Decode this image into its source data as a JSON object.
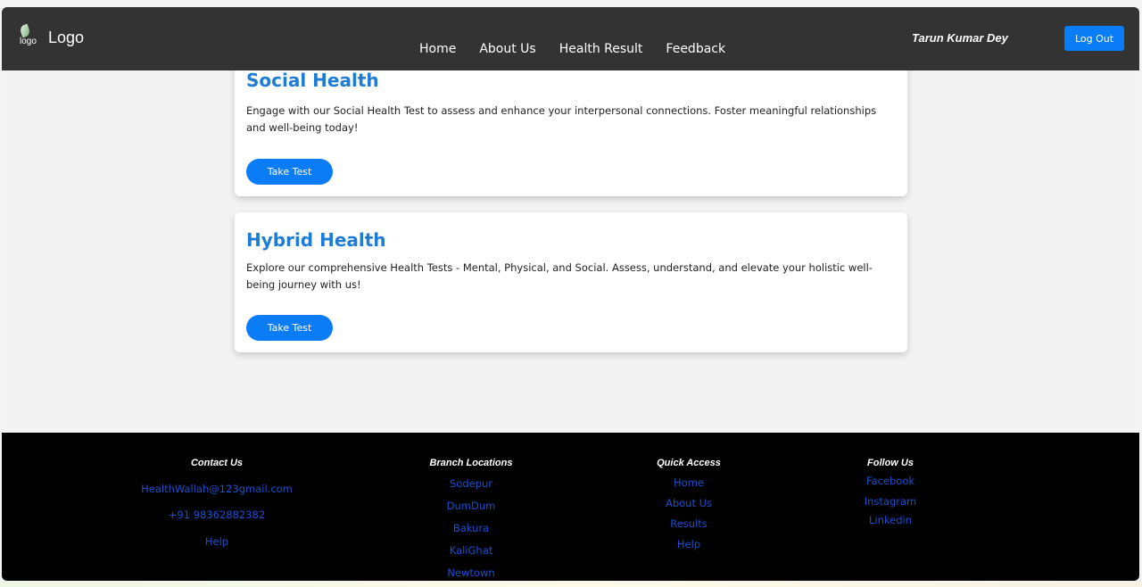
{
  "navbar": {
    "logo_alt": "logo",
    "logo_text": "Logo",
    "links": [
      "Home",
      "About Us",
      "Health Result",
      "Feedback"
    ],
    "user_name": "Tarun Kumar Dey",
    "logout_label": "Log Out"
  },
  "cards": [
    {
      "title": "Social Health",
      "description": "Engage with our Social Health Test to assess and enhance your interpersonal connections. Foster meaningful relationships and well-being today!",
      "button_label": "Take Test"
    },
    {
      "title": "Hybrid Health",
      "description": "Explore our comprehensive Health Tests - Mental, Physical, and Social. Assess, understand, and elevate your holistic well-being journey with us!",
      "button_label": "Take Test"
    }
  ],
  "footer": {
    "contact": {
      "heading": "Contact Us",
      "items": [
        "HealthWallah@123gmail.com",
        "+91 98362882382",
        "Help"
      ]
    },
    "branches": {
      "heading": "Branch Locations",
      "items": [
        "Sodepur",
        "DumDum",
        "Bakura",
        "KaliGhat",
        "Newtown"
      ]
    },
    "quick_access": {
      "heading": "Quick Access",
      "items": [
        "Home",
        "About Us",
        "Results",
        "Help"
      ]
    },
    "follow": {
      "heading": "Follow Us",
      "items": [
        "Facebook",
        "Instagram",
        "Linkedin"
      ]
    }
  },
  "colors": {
    "navbar_bg": "#333333",
    "accent": "#0a7cf5",
    "card_title": "#1e7cd6",
    "footer_bg": "#000000",
    "footer_link": "#1a4fd0"
  }
}
